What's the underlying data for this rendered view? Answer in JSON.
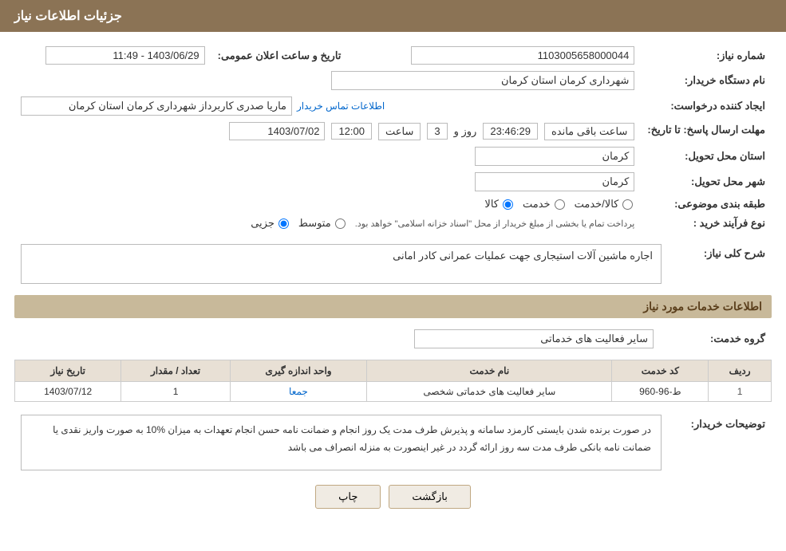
{
  "header": {
    "title": "جزئیات اطلاعات نیاز"
  },
  "form": {
    "need_number_label": "شماره نیاز:",
    "need_number_value": "1103005658000044",
    "announce_datetime_label": "تاریخ و ساعت اعلان عمومی:",
    "announce_datetime_value": "1403/06/29 - 11:49",
    "buyer_org_label": "نام دستگاه خریدار:",
    "buyer_org_value": "شهرداری کرمان استان کرمان",
    "requester_label": "ایجاد کننده درخواست:",
    "requester_value": "ماریا صدری کاربرداز شهرداری کرمان استان کرمان",
    "contact_link": "اطلاعات تماس خریدار",
    "response_deadline_label": "مهلت ارسال پاسخ: تا تاریخ:",
    "response_date_value": "1403/07/02",
    "response_time_label": "ساعت",
    "response_time_value": "12:00",
    "remaining_days_label": "روز و",
    "remaining_days_value": "3",
    "remaining_time_value": "23:46:29",
    "remaining_label": "ساعت باقی مانده",
    "province_label": "استان محل تحویل:",
    "province_value": "کرمان",
    "city_label": "شهر محل تحویل:",
    "city_value": "کرمان",
    "category_label": "طبقه بندی موضوعی:",
    "category_options": [
      "کالا",
      "خدمت",
      "کالا/خدمت"
    ],
    "category_selected": "کالا",
    "process_label": "نوع فرآیند خرید :",
    "process_options": [
      "جزیی",
      "متوسط"
    ],
    "process_note": "پرداخت تمام یا بخشی از مبلغ خریدار از محل \"اسناد خزانه اسلامی\" خواهد بود.",
    "description_label": "شرح کلی نیاز:",
    "description_value": "اجاره ماشین آلات استیجاری جهت عملیات عمرانی کادر امانی",
    "services_section_title": "اطلاعات خدمات مورد نیاز",
    "service_group_label": "گروه خدمت:",
    "service_group_value": "سایر فعالیت های خدماتی",
    "table_headers": [
      "ردیف",
      "کد خدمت",
      "نام خدمت",
      "واحد اندازه گیری",
      "تعداد / مقدار",
      "تاریخ نیاز"
    ],
    "table_rows": [
      {
        "row_num": "1",
        "service_code": "ط-96-960",
        "service_name": "سایر فعالیت های خدماتی شخصی",
        "unit": "جمعا",
        "quantity": "1",
        "date": "1403/07/12"
      }
    ],
    "notes_label": "توضیحات خریدار:",
    "notes_value": "در صورت برنده شدن بایستی کارمزد سامانه و پذیرش طرف مدت یک روز انجام و ضمانت نامه حسن انجام تعهدات به میزان %10  به صورت واریز نقدی یا ضمانت نامه بانکی طرف مدت سه روز ارائه گردد در غیر اینصورت به منزله انصراف می باشد",
    "btn_back": "بازگشت",
    "btn_print": "چاپ"
  }
}
